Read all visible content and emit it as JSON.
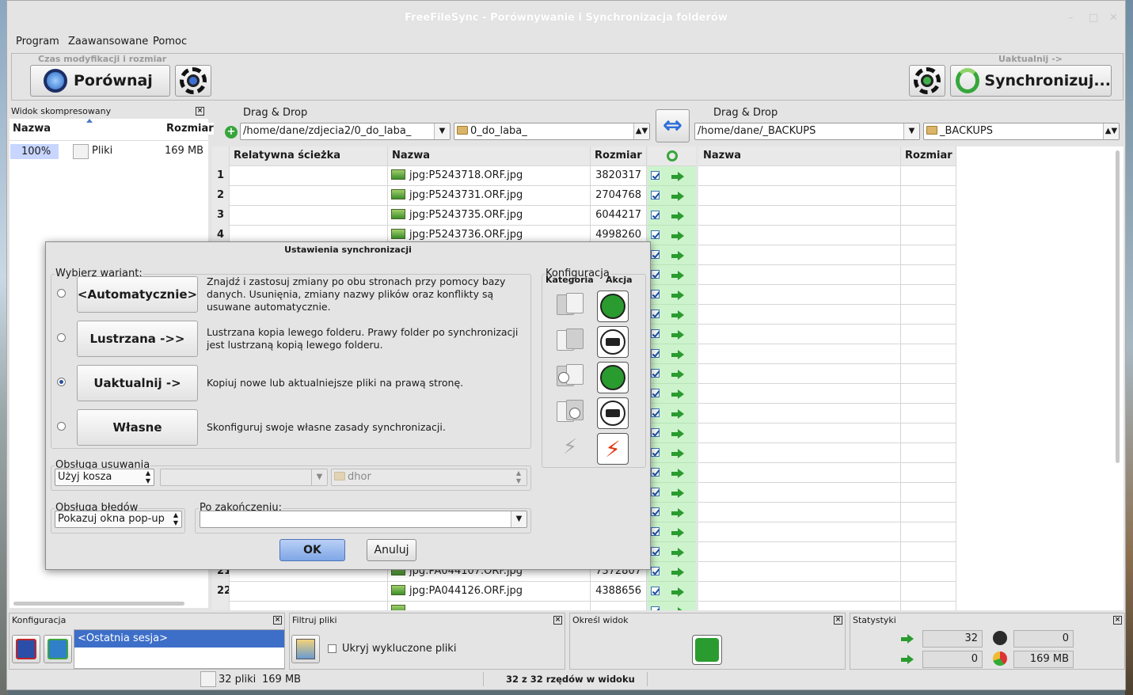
{
  "window": {
    "title": "FreeFileSync - Porównywanie i Synchronizacja folderów"
  },
  "menu": [
    "Program",
    "Zaawansowane",
    "Pomoc"
  ],
  "toolbar": {
    "compare_hint": "Czas modyfikacji i rozmiar",
    "compare_label": "Porównaj",
    "sync_hint": "Uaktualnij ->",
    "sync_label": "Synchronizuj..."
  },
  "compressed_view": {
    "title": "Widok skompresowany",
    "col_name": "Nazwa",
    "col_size": "Rozmiar",
    "row": {
      "percent": "100%",
      "name": "Pliki",
      "size": "169 MB"
    }
  },
  "left_folder": {
    "drag_drop": "Drag & Drop",
    "path": "/home/dane/zdjecia2/0_do_laba_",
    "name": "0_do_laba_"
  },
  "right_folder": {
    "drag_drop": "Drag & Drop",
    "path": "/home/dane/_BACKUPS",
    "name": "_BACKUPS"
  },
  "grid": {
    "left_headers": {
      "rel_path": "Relatywna ścieżka",
      "name": "Nazwa",
      "size": "Rozmiar"
    },
    "right_headers": {
      "name": "Nazwa",
      "size": "Rozmiar"
    },
    "rows_top": [
      {
        "n": "1",
        "name": "jpg:P5243718.ORF.jpg",
        "size": "3820317"
      },
      {
        "n": "2",
        "name": "jpg:P5243731.ORF.jpg",
        "size": "2704768"
      },
      {
        "n": "3",
        "name": "jpg:P5243735.ORF.jpg",
        "size": "6044217"
      },
      {
        "n": "4",
        "name": "jpg:P5243736.ORF.jpg",
        "size": "4998260"
      }
    ],
    "rows_bottom": [
      {
        "n": "21",
        "name": "jpg:PA044107.ORF.jpg",
        "size": "7372807"
      },
      {
        "n": "22",
        "name": "jpg:PA044126.ORF.jpg",
        "size": "4388656"
      }
    ]
  },
  "dialog": {
    "title": "Ustawienia synchronizacji",
    "choose_variant": "Wybierz wariant:",
    "variants": [
      {
        "label": "<Automatycznie>",
        "desc": "Znajdź i zastosuj zmiany po obu stronach przy pomocy bazy danych. Usunięnia, zmiany nazwy plików oraz konflikty są usuwane automatycznie.",
        "selected": false
      },
      {
        "label": "Lustrzana ->>",
        "desc": "Lustrzana kopia lewego folderu. Prawy folder po synchronizacji jest lustrzaną kopią lewego folderu.",
        "selected": false
      },
      {
        "label": "Uaktualnij ->",
        "desc": "Kopiuj nowe lub aktualniejsze pliki na prawą stronę.",
        "selected": true
      },
      {
        "label": "Własne",
        "desc": "Skonfiguruj swoje własne zasady synchronizacji.",
        "selected": false
      }
    ],
    "config": {
      "title": "Konfiguracja",
      "category": "Kategoria",
      "action": "Akcja"
    },
    "deletion": {
      "title": "Obsługa usuwania",
      "value": "Użyj kosza",
      "folder": "dhor"
    },
    "errors": {
      "title": "Obsługa błędów",
      "value": "Pokazuj okna pop-up"
    },
    "on_completion": {
      "title": "Po zakończeniu:",
      "value": ""
    },
    "ok": "OK",
    "cancel": "Anuluj"
  },
  "bottom": {
    "config_title": "Konfiguracja",
    "last_session": "<Ostatnia sesja>",
    "filter_title": "Filtruj pliki",
    "hide_excluded": "Ukryj wykluczone pliki",
    "view_title": "Określ widok",
    "stats_title": "Statystyki",
    "stats": {
      "create_right": "32",
      "delete": "0",
      "update": "0",
      "data": "169 MB"
    }
  },
  "status": {
    "files": "32 pliki",
    "size": "169 MB",
    "rows": "32 z 32 rzędów w widoku"
  }
}
